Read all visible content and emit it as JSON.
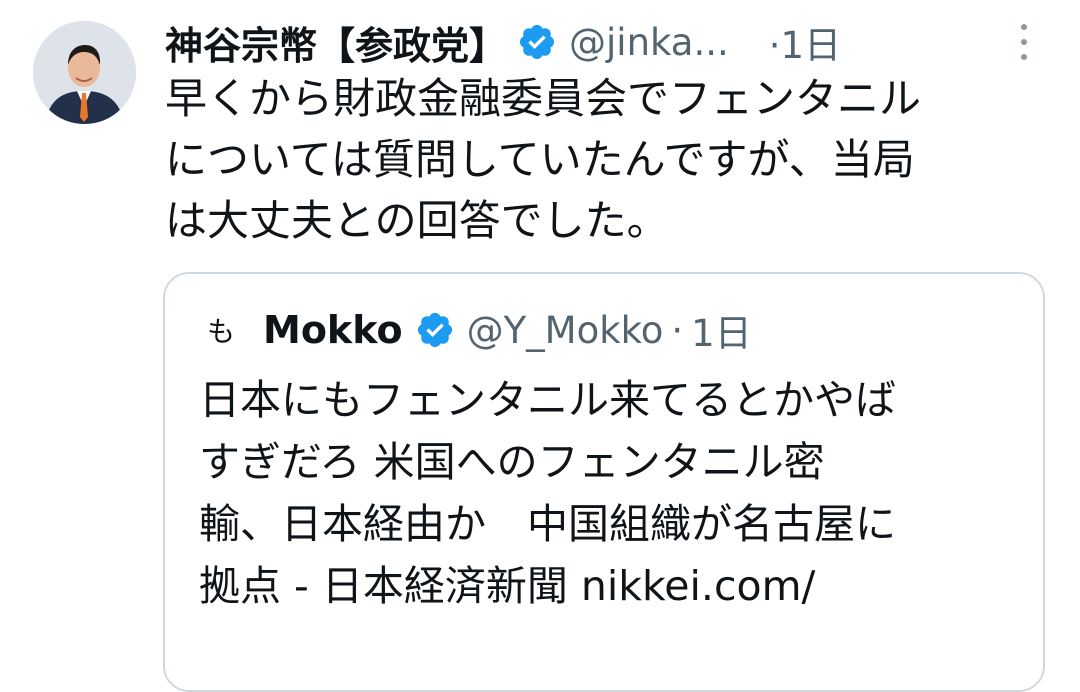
{
  "tweet": {
    "author_name": "神谷宗幣【参政党】",
    "handle": "@jinka...",
    "time": "·1日",
    "text_lines": [
      "早くから財政金融委員会でフェンタニル",
      "については質問していたんですが、当局",
      "は大丈夫との回答でした。"
    ]
  },
  "quoted_tweet": {
    "avatar_glyph": "も",
    "author_name": "Mokko",
    "handle": "@Y_Mokko",
    "separator": "·",
    "time": "1日",
    "text_lines": [
      "日本にもフェンタニル来てるとかやば",
      "すぎだろ 米国へのフェンタニル密",
      "輸、日本経由か　中国組織が名古屋に",
      "拠点 - 日本経済新聞 nikkei.com/"
    ]
  },
  "icons": {
    "verified": "verified-badge-icon",
    "more": "more-vertical-icon",
    "colors": {
      "verified": "#1d9bf0",
      "secondary_text": "#536471",
      "border": "#cfd9de"
    }
  }
}
